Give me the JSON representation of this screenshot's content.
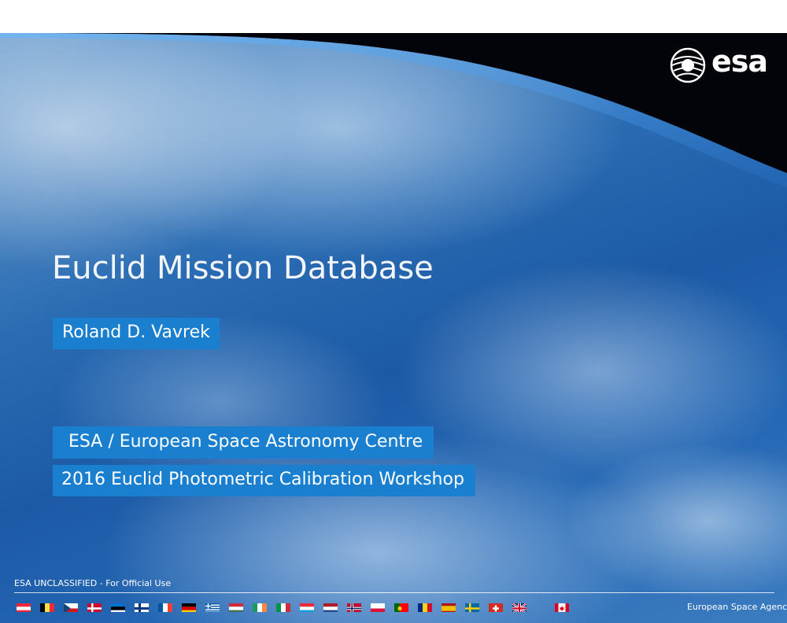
{
  "slide": {
    "title": "Euclid Mission Database",
    "author": "Roland D. Vavrek",
    "organization": "ESA / European Space Astronomy Centre",
    "event": "2016 Euclid Photometric Calibration Workshop",
    "logo_text": "esa",
    "classification": "ESA UNCLASSIFIED - For Official Use",
    "agency_name": "European Space Agency"
  },
  "footer": {
    "flags": [
      "austria",
      "belgium",
      "czech-republic",
      "denmark",
      "estonia",
      "finland",
      "france",
      "germany",
      "greece",
      "hungary",
      "ireland",
      "italy",
      "luxembourg",
      "netherlands",
      "norway",
      "poland",
      "portugal",
      "romania",
      "spain",
      "sweden",
      "switzerland",
      "united-kingdom",
      "canada"
    ]
  },
  "colors": {
    "text_box": "#1a7fce",
    "space": "#000000"
  }
}
